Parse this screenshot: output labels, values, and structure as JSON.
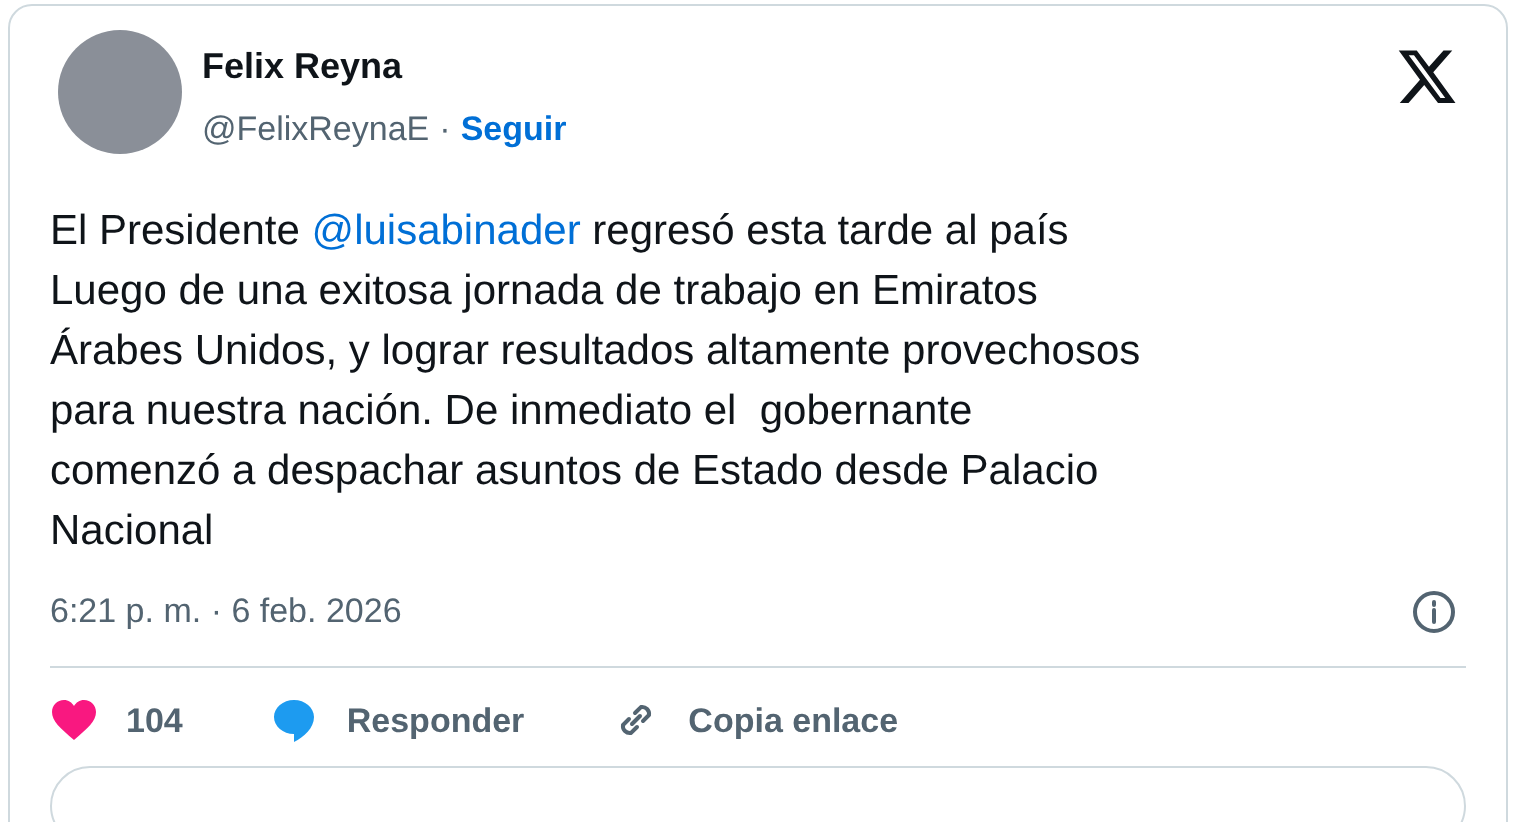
{
  "author": {
    "name": "Felix Reyna",
    "handle": "@FelixReynaE",
    "separator": "·",
    "follow": "Seguir"
  },
  "tweet": {
    "text_before": "El Presidente ",
    "mention": "@luisabinader",
    "text_after": " regresó esta tarde al país\nLuego de una exitosa jornada de trabajo en Emiratos\nÁrabes Unidos, y lograr resultados altamente provechosos\npara nuestra nación. De inmediato el  gobernante\ncomenzó a despachar asuntos de Estado desde Palacio\nNacional"
  },
  "timestamp": "6:21 p. m. · 6 feb. 2026",
  "actions": [
    {
      "kind": "like",
      "label": "104"
    },
    {
      "kind": "reply",
      "label": "Responder"
    },
    {
      "kind": "copy",
      "label": "Copia enlace"
    }
  ]
}
